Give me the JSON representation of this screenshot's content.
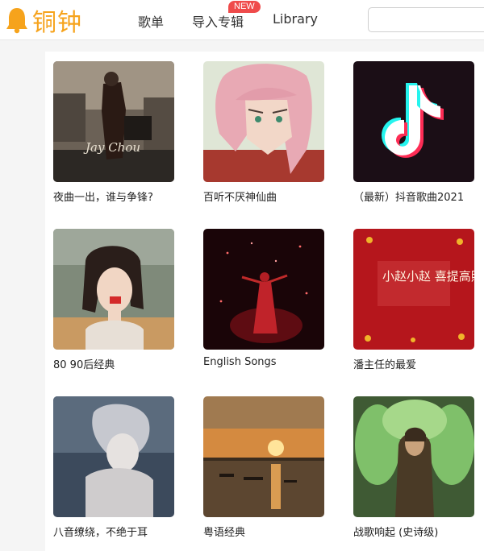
{
  "app": {
    "logo_text": "铜钟"
  },
  "nav": {
    "items": [
      "歌单",
      "导入专辑",
      "Library"
    ],
    "new_badge": "NEW"
  },
  "search": {
    "placeholder": ""
  },
  "playlists": [
    {
      "title": "夜曲一出，谁与争锋?",
      "cover_overlay": "Jay Chou"
    },
    {
      "title": "百听不厌神仙曲"
    },
    {
      "title": "（最新）抖音歌曲2021"
    },
    {
      "title": "80 90后经典"
    },
    {
      "title": "English Songs"
    },
    {
      "title": "潘主任的最爱",
      "cover_overlay": "小赵小赵 喜提高照"
    },
    {
      "title": "八音缭绕，不绝于耳"
    },
    {
      "title": "粤语经典"
    },
    {
      "title": "战歌响起 (史诗级)"
    }
  ],
  "colors": {
    "brand": "#f6a31c",
    "badge": "#ef4b4b"
  }
}
